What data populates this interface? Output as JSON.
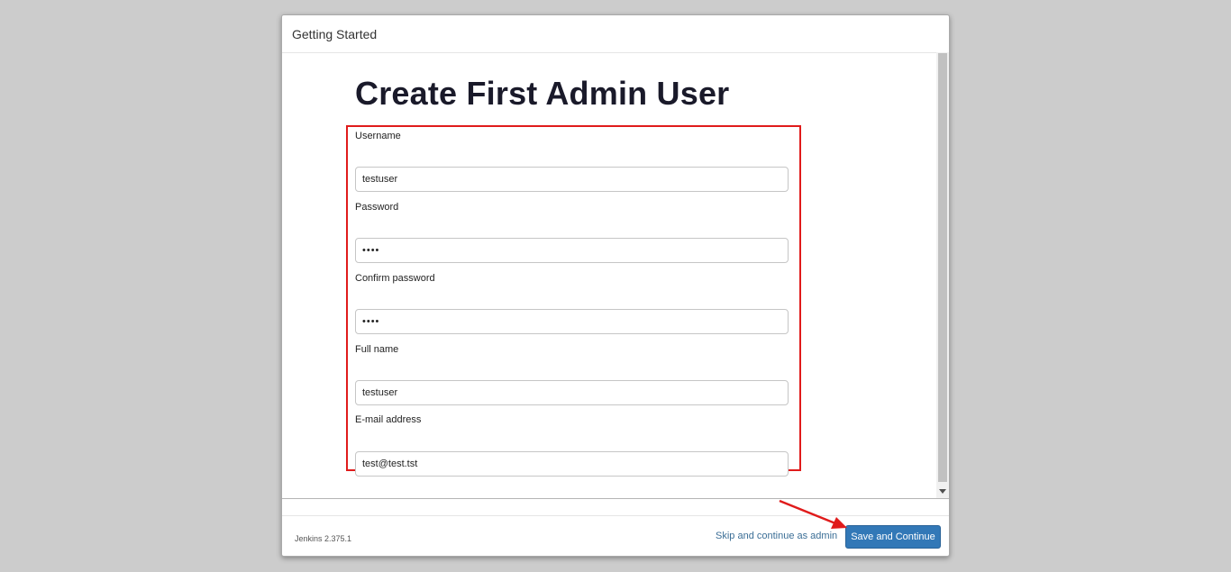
{
  "dialog": {
    "title": "Getting Started"
  },
  "page": {
    "title": "Create First Admin User"
  },
  "form": {
    "fields": [
      {
        "label": "Username",
        "value": "testuser",
        "type": "text"
      },
      {
        "label": "Password",
        "value": "••••",
        "type": "password"
      },
      {
        "label": "Confirm password",
        "value": "••••",
        "type": "password"
      },
      {
        "label": "Full name",
        "value": "testuser",
        "type": "text"
      },
      {
        "label": "E-mail address",
        "value": "test@test.tst",
        "type": "text"
      }
    ]
  },
  "footer": {
    "version": "Jenkins 2.375.1",
    "skip_label": "Skip and continue as admin",
    "save_label": "Save and Continue"
  },
  "colors": {
    "highlight": "#e01b1b",
    "primary_button": "#3278b7",
    "link": "#3b6e96"
  },
  "icons": {
    "scroll_down": "chevron-down-icon",
    "annotation_arrow": "arrow-annotation-icon"
  }
}
